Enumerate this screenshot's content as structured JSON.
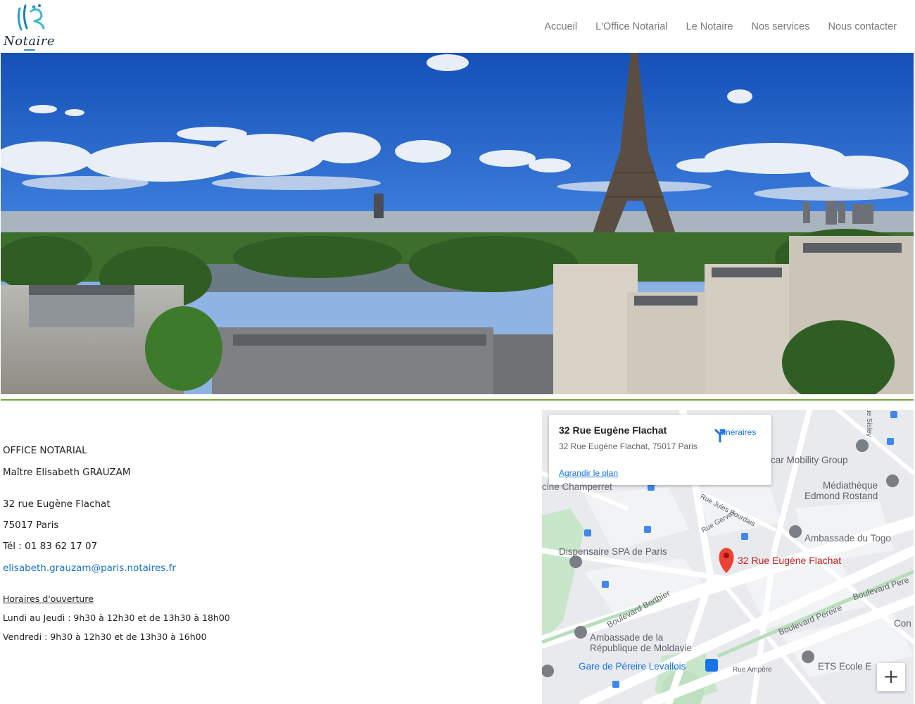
{
  "brand": {
    "logo_text": "Notaire"
  },
  "nav": [
    {
      "label": "Accueil"
    },
    {
      "label": "L'Office Notarial"
    },
    {
      "label": "Le Notaire"
    },
    {
      "label": "Nos services"
    },
    {
      "label": "Nous contacter"
    }
  ],
  "contact": {
    "office": "OFFICE NOTARIAL",
    "name": "Maître Elisabeth GRAUZAM",
    "street": "32 rue Eugène Flachat",
    "city": "75017 Paris",
    "phone": "Tél : 01 83 62 17 07",
    "email": "elisabeth.grauzam@paris.notaires.fr",
    "hours_title": "Horaires d'ouverture",
    "hours_1": "Lundi au Jeudi : 9h30 à 12h30 et de 13h30 à 18h00",
    "hours_2": "Vendredi : 9h30 à 12h30 et de 13h30 à 16h00"
  },
  "map": {
    "card_title": "32 Rue Eugène Flachat",
    "card_address": "32 Rue Eugène Flachat, 75017 Paris",
    "directions": "Itinéraires",
    "enlarge": "Agrandir le plan",
    "pin_label": "32 Rue Eugène Flachat",
    "zoom_in": "+",
    "labels": {
      "mobility": "car Mobility Group",
      "champerret": "cine Champerret",
      "mediatheque_1": "Médiathèque",
      "mediatheque_2": "Edmond Rostand",
      "jules_bourdais": "Rue Jules Bourdais",
      "gervex": "Rue Gervex",
      "togo": "Ambassade du Togo",
      "spa": "Dispensaire SPA de Paris",
      "berthier": "Boulevard Berthier",
      "pereire": "Boulevard Pereire",
      "pereire_2": "Boulevard Pere",
      "moldavie_1": "Ambassade de la",
      "moldavie_2": "République de Moldavie",
      "gare": "Gare de Péreire Levallois",
      "ampere": "Rue Ampère",
      "ets": "ETS Ecole E",
      "con": "Con",
      "sisley": "ue Sisley"
    }
  }
}
